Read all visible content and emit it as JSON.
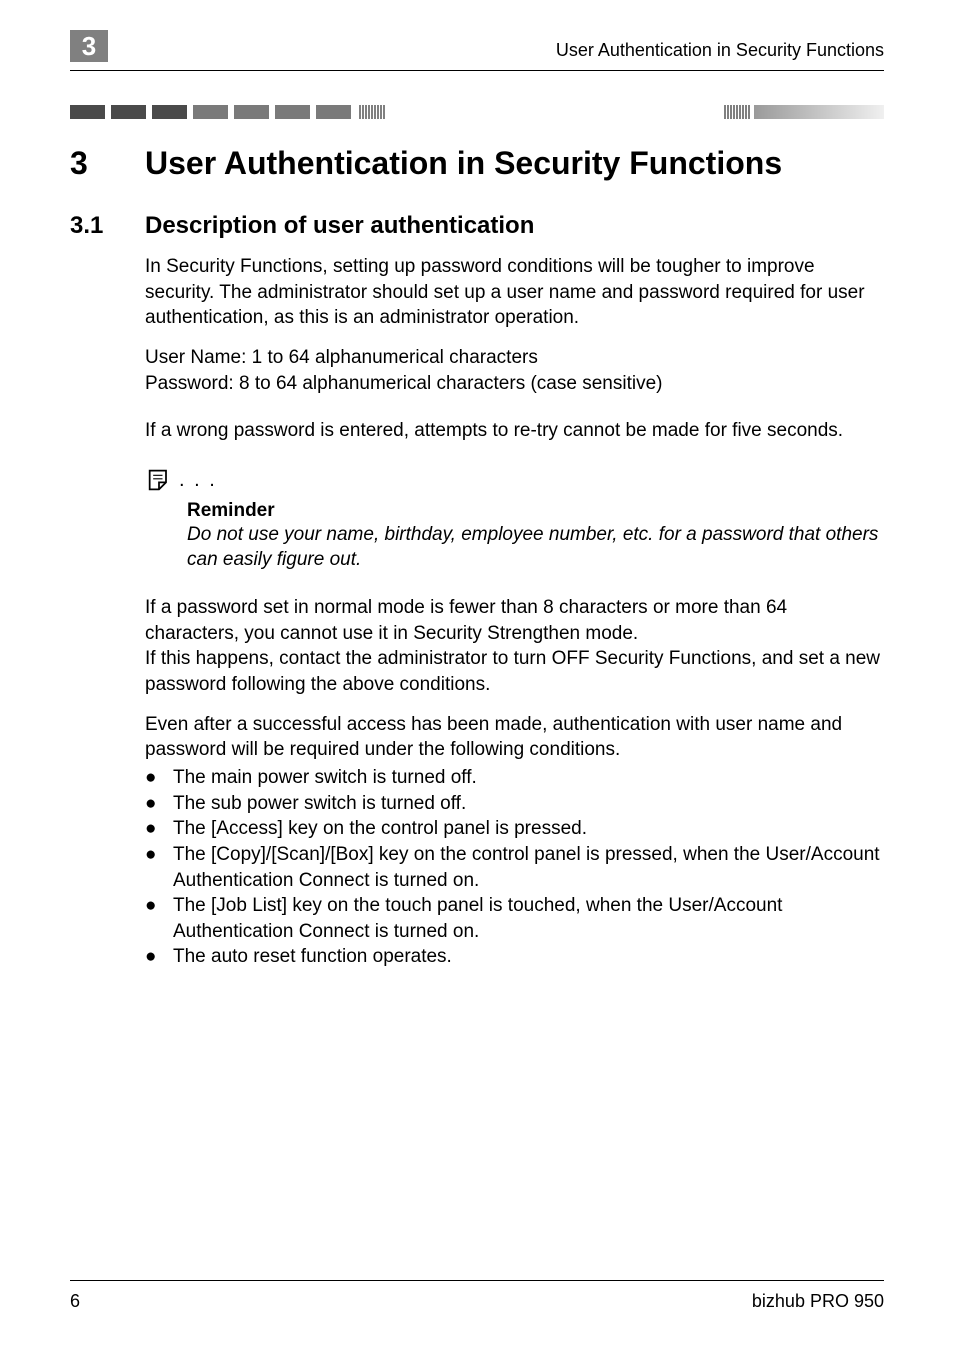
{
  "page": {
    "chapter_marker": "3",
    "running_header": "User Authentication in Security Functions",
    "page_number": "6",
    "product_name": "bizhub PRO 950"
  },
  "main_title": {
    "number": "3",
    "text": "User Authentication in Security Functions"
  },
  "section": {
    "number": "3.1",
    "title": "Description of user authentication"
  },
  "paragraphs": {
    "p1": "In Security Functions, setting up password conditions will be tougher to improve security. The administrator should set up a user name and password required for user authentication, as this is an administrator operation.",
    "p2_line1": "User Name: 1 to 64 alphanumerical characters",
    "p2_line2": "Password: 8 to 64 alphanumerical characters (case sensitive)",
    "p3": "If a wrong password is entered, attempts to re-try cannot be made for five seconds.",
    "p4_line1": "If a password set in normal mode is fewer than 8 characters or more than 64 characters, you cannot use it in Security Strengthen mode.",
    "p4_line2": "If this happens, contact the administrator to turn OFF Security Functions, and set a new password following the above conditions.",
    "p5": "Even after a successful access has been made, authentication with user name and password will be required under the following conditions."
  },
  "reminder": {
    "label": "Reminder",
    "text": "Do not use your name, birthday, employee number, etc. for a password that others can easily figure out."
  },
  "bullets": [
    "The main power switch is turned off.",
    "The sub power switch is turned off.",
    "The [Access] key on the control panel is pressed.",
    "The [Copy]/[Scan]/[Box] key on the control panel is pressed, when the User/Account Authentication Connect is turned on.",
    "The [Job List] key on the touch panel is touched, when the User/Account Authentication Connect is turned on.",
    "The auto reset function operates."
  ]
}
